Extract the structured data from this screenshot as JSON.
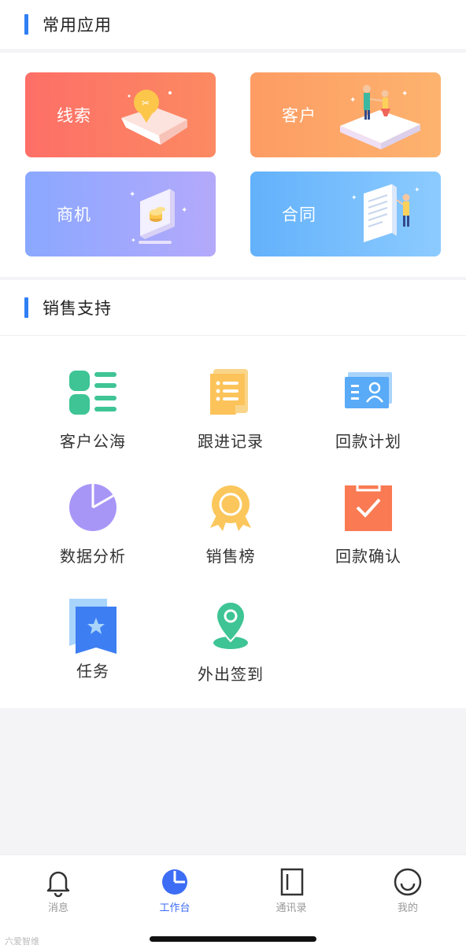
{
  "common_apps": {
    "title": "常用应用",
    "cards": [
      {
        "label": "线索",
        "icon": "lead-location-icon"
      },
      {
        "label": "客户",
        "icon": "customer-handshake-icon"
      },
      {
        "label": "商机",
        "icon": "opportunity-coins-icon"
      },
      {
        "label": "合同",
        "icon": "contract-document-icon"
      }
    ]
  },
  "sales_support": {
    "title": "销售支持",
    "items": [
      {
        "label": "客户公海",
        "icon": "grid-list-icon"
      },
      {
        "label": "跟进记录",
        "icon": "notes-icon"
      },
      {
        "label": "回款计划",
        "icon": "id-card-icon"
      },
      {
        "label": "数据分析",
        "icon": "pie-chart-icon"
      },
      {
        "label": "销售榜",
        "icon": "medal-icon"
      },
      {
        "label": "回款确认",
        "icon": "checkmark-board-icon"
      },
      {
        "label": "任务",
        "icon": "star-flag-icon"
      },
      {
        "label": "外出签到",
        "icon": "location-pin-icon"
      }
    ]
  },
  "tabbar": {
    "tabs": [
      {
        "label": "消息",
        "icon": "bell-icon"
      },
      {
        "label": "工作台",
        "icon": "dashboard-icon",
        "active": true
      },
      {
        "label": "通讯录",
        "icon": "contacts-book-icon"
      },
      {
        "label": "我的",
        "icon": "smiley-icon"
      }
    ]
  },
  "watermark": "六爱智维",
  "colors": {
    "accent": "#2f7ff5",
    "active_tab": "#3d6df5"
  }
}
